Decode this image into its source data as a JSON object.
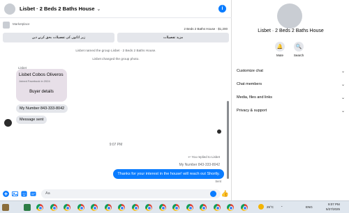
{
  "header": {
    "title": "Lisbet · 2 Beds 2 Baths House",
    "chevron": "⌄",
    "info_glyph": "i"
  },
  "marketplace": {
    "label": "Marketplace",
    "price_line": "2 Beds 2 Baths House · $1,200",
    "button_left": "زیر اثاثوں کی تفصیلات بحق کرنے دیں",
    "button_right": "مزید تفصیلات"
  },
  "system_messages": [
    "Lisbet named the group Lisbet · 2 Beds 2 Baths House.",
    "Lisbet changed the group photo."
  ],
  "incoming": {
    "sender_label": "Lisbet",
    "contact_name": "Lisbet Cobos Oliveros",
    "contact_joined": "Joined Facebook in 2024",
    "contact_button": "Buyer details",
    "phone_message": "My Number 843-333-8042",
    "message_sent": "Message sent"
  },
  "timestamp": "9:07 PM",
  "outgoing": {
    "replied_note": "You replied to Lisbet",
    "quoted": "My Number 843-333-8042",
    "message": "Thanks for your interest in the house! will reach out Shortly.",
    "status": "Sent"
  },
  "composer": {
    "placeholder": "Aa",
    "plus_glyph": "+",
    "like_glyph": "👍"
  },
  "side_panel": {
    "name": "Lisbet · 2 Beds 2 Baths House",
    "actions": [
      {
        "label": "Mute",
        "glyph": "🔔"
      },
      {
        "label": "Search",
        "glyph": "🔍"
      }
    ],
    "sections": [
      "Customize chat",
      "Chat members",
      "Media, files and links",
      "Privacy & support"
    ],
    "chevron": "⌄"
  },
  "taskbar": {
    "weather": "25°C",
    "language": "ENG",
    "time": "9:07 PM",
    "date": "5/27/2025",
    "chrome_count": 16
  },
  "colors": {
    "accent": "#0a7cff",
    "bubble_gray": "#e4e6eb",
    "contact_card": "#e7dfe8",
    "taskbar": "#dfe6ee"
  }
}
